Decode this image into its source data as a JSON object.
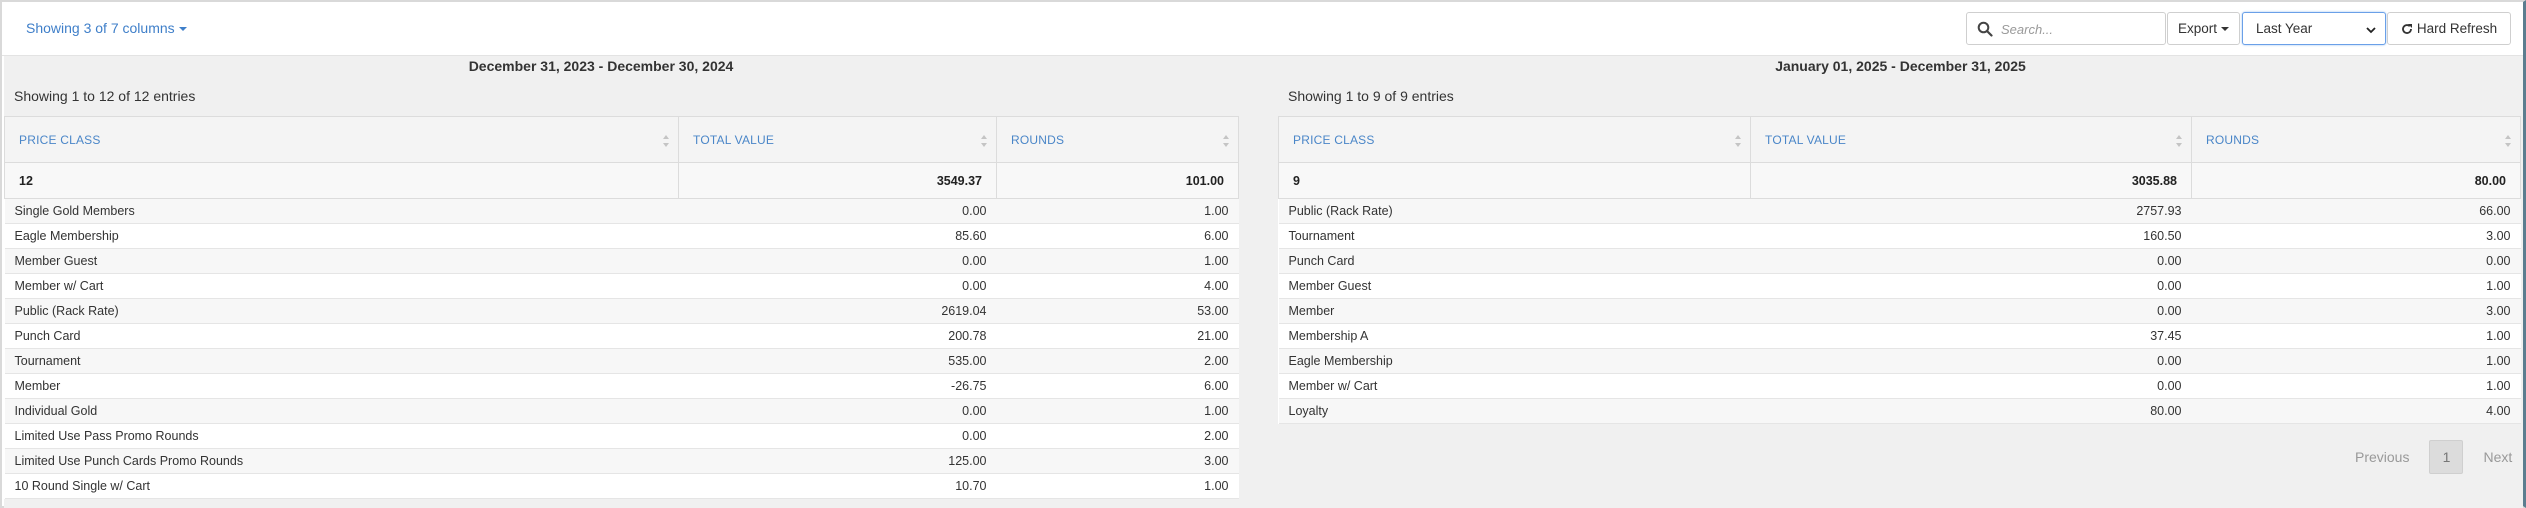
{
  "toolbar": {
    "column_visibility": "Showing 3 of 7 columns",
    "search_placeholder": "Search...",
    "export_label": "Export",
    "period_selected": "Last Year",
    "refresh_label": "Hard Refresh"
  },
  "left": {
    "title": "December 31, 2023 - December 30, 2024",
    "info": "Showing 1 to 12 of 12 entries",
    "columns": [
      "PRICE CLASS",
      "TOTAL VALUE",
      "ROUNDS"
    ],
    "summary": [
      "12",
      "3549.37",
      "101.00"
    ],
    "rows": [
      [
        "Single Gold Members",
        "0.00",
        "1.00"
      ],
      [
        "Eagle Membership",
        "85.60",
        "6.00"
      ],
      [
        "Member Guest",
        "0.00",
        "1.00"
      ],
      [
        "Member w/ Cart",
        "0.00",
        "4.00"
      ],
      [
        "Public (Rack Rate)",
        "2619.04",
        "53.00"
      ],
      [
        "Punch Card",
        "200.78",
        "21.00"
      ],
      [
        "Tournament",
        "535.00",
        "2.00"
      ],
      [
        "Member",
        "-26.75",
        "6.00"
      ],
      [
        "Individual Gold",
        "0.00",
        "1.00"
      ],
      [
        "Limited Use Pass Promo Rounds",
        "0.00",
        "2.00"
      ],
      [
        "Limited Use Punch Cards Promo Rounds",
        "125.00",
        "3.00"
      ],
      [
        "10 Round Single w/ Cart",
        "10.70",
        "1.00"
      ]
    ]
  },
  "right": {
    "title": "January 01, 2025 - December 31, 2025",
    "info": "Showing 1 to 9 of 9 entries",
    "columns": [
      "PRICE CLASS",
      "TOTAL VALUE",
      "ROUNDS"
    ],
    "summary": [
      "9",
      "3035.88",
      "80.00"
    ],
    "rows": [
      [
        "Public (Rack Rate)",
        "2757.93",
        "66.00"
      ],
      [
        "Tournament",
        "160.50",
        "3.00"
      ],
      [
        "Punch Card",
        "0.00",
        "0.00"
      ],
      [
        "Member Guest",
        "0.00",
        "1.00"
      ],
      [
        "Member",
        "0.00",
        "3.00"
      ],
      [
        "Membership A",
        "37.45",
        "1.00"
      ],
      [
        "Eagle Membership",
        "0.00",
        "1.00"
      ],
      [
        "Member w/ Cart",
        "0.00",
        "1.00"
      ],
      [
        "Loyalty",
        "80.00",
        "4.00"
      ]
    ],
    "pagination": {
      "previous": "Previous",
      "current": "1",
      "next": "Next"
    }
  }
}
